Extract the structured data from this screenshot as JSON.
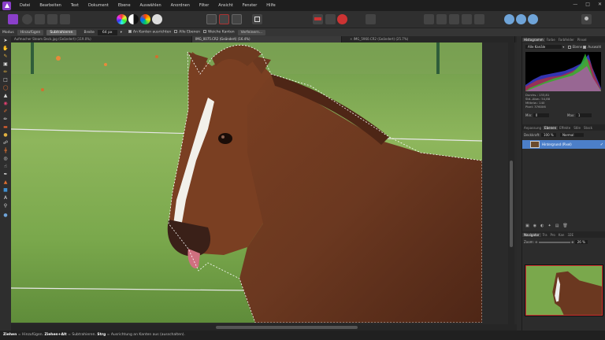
{
  "menu": [
    "Datei",
    "Bearbeiten",
    "Text",
    "Dokument",
    "Ebene",
    "Auswählen",
    "Anordnen",
    "Filter",
    "Ansicht",
    "Fenster",
    "Hilfe"
  ],
  "context": {
    "mode_label": "Modus",
    "mode_add": "Hinzufügen",
    "mode_subtract": "Subtrahieren",
    "width_label": "Breite",
    "width_value": "64 px",
    "snap_edges": "An Kanten ausrichten",
    "all_layers": "Alle Ebenen",
    "soft_edges": "Weiche Kanten",
    "refine": "Verfeinern..."
  },
  "tabs": [
    {
      "label": "Aufmacher Steam Deck.jpg (Geändert) (119.0%)"
    },
    {
      "label": "IMG_0075.CR2 (Geändert) (16.4%)"
    },
    {
      "label": "IMG_5960.CR2 (Geändert) (25.7%)"
    }
  ],
  "histogram": {
    "tabs": [
      "Histogramm",
      "Farbe",
      "Farbfelder",
      "Pinsel"
    ],
    "channel": "Alle Kanäle",
    "layer_label": "Ebene",
    "selection_label": "Auswahl",
    "stats": [
      "Durchs.: 133,81",
      "Std.-Abw.: 54,88",
      "Mittelw.: 140",
      "Pixel: 376006"
    ],
    "min_label": "Min:",
    "min_value": "0",
    "max_label": "Max:",
    "max_value": "1"
  },
  "layers": {
    "tabs": [
      "Anpassung",
      "Ebenen",
      "Effekte",
      "Stile",
      "Stock"
    ],
    "opacity_label": "Deckkraft:",
    "opacity_value": "100 %",
    "blend": "Normal",
    "layer_name": "Hintergrund (Pixel)"
  },
  "navigator": {
    "tabs": [
      "Navigator",
      "Tra",
      "Pro",
      "Kan",
      "32E"
    ],
    "zoom_label": "Zoom:",
    "zoom_value": "26 %"
  },
  "status": {
    "k1": "Ziehen",
    "t1": " = Hinzufügen. ",
    "k2": "Ziehen+Alt",
    "t2": " = Subtrahieren. ",
    "k3": "Strg",
    "t3": " = Ausrichtung an Kanten aus (ausschalten)."
  },
  "colors": {
    "accent": "#8a3fc9",
    "layer_selected": "#4c7fc9"
  }
}
